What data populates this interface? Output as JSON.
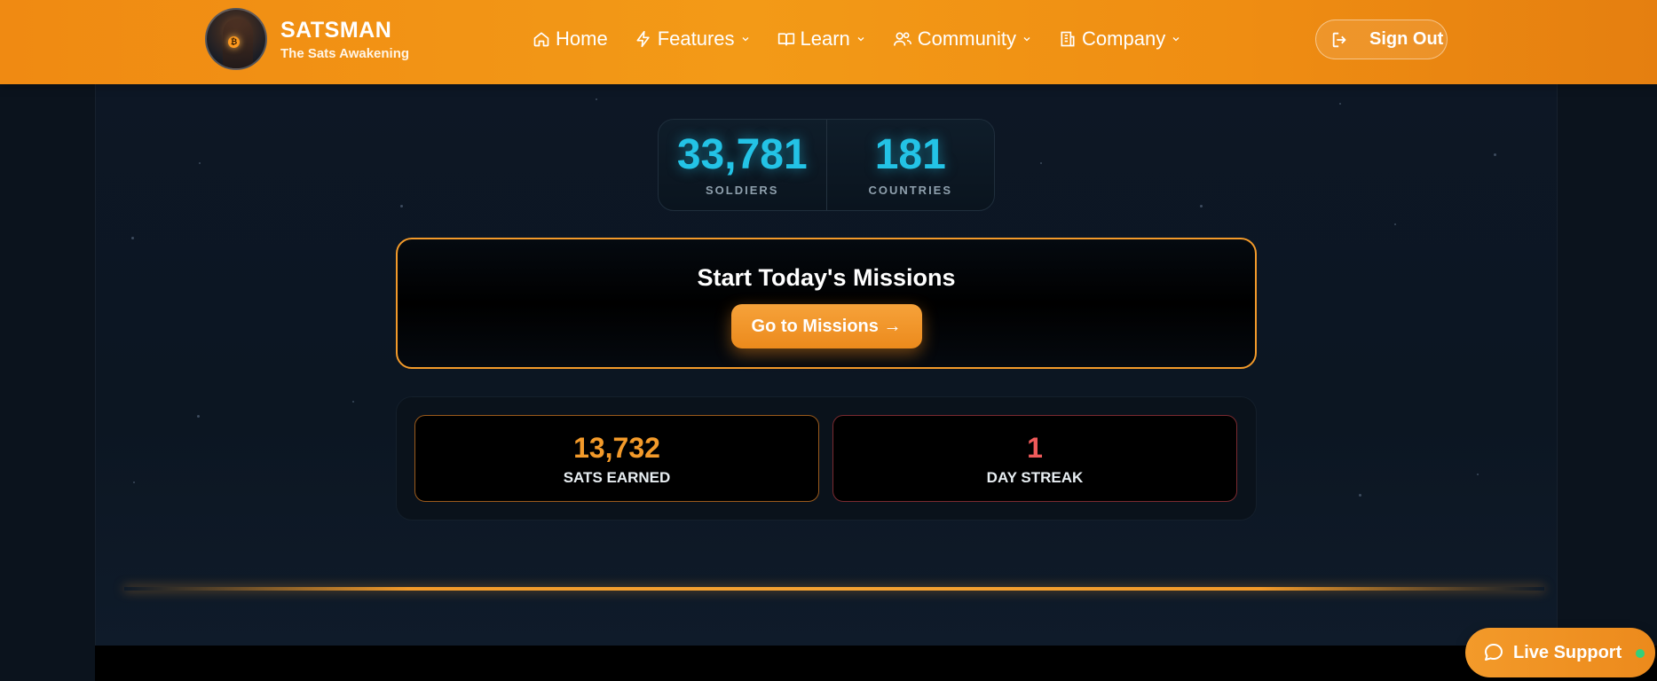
{
  "brand": {
    "name": "SATSMAN",
    "tagline": "The Sats Awakening"
  },
  "nav": {
    "home": "Home",
    "features": "Features",
    "learn": "Learn",
    "community": "Community",
    "company": "Company"
  },
  "header": {
    "signout_label": "Sign Out"
  },
  "stats": {
    "soldiers_value": "33,781",
    "soldiers_label": "SOLDIERS",
    "countries_value": "181",
    "countries_label": "COUNTRIES"
  },
  "missions": {
    "title": "Start Today's Missions",
    "button_label": "Go to Missions →"
  },
  "progress": {
    "sats_value": "13,732",
    "sats_label": "SATS EARNED",
    "streak_value": "1",
    "streak_label": "DAY STREAK"
  },
  "support": {
    "label": "Live Support"
  },
  "colors": {
    "accent_orange": "#f39a2a",
    "stat_cyan": "#23c3e6",
    "streak_red": "#ef5a5a",
    "online_green": "#33d07a"
  }
}
